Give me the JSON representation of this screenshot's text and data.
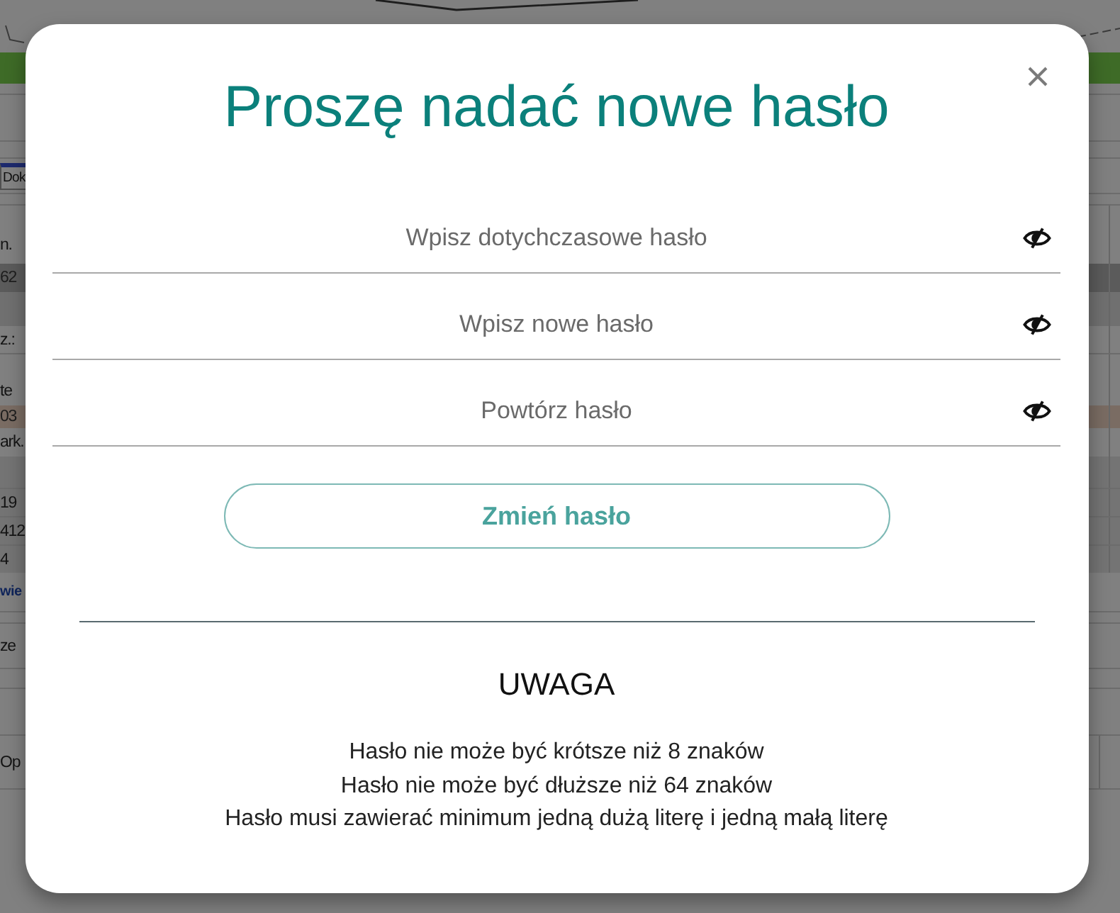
{
  "background_page": {
    "fragments": [
      {
        "text": "Dok",
        "kind": "tab"
      },
      {
        "text": "n.",
        "kind": "text"
      },
      {
        "text": "62",
        "kind": "text"
      },
      {
        "text": "z.:",
        "kind": "text"
      },
      {
        "text": "te",
        "kind": "text"
      },
      {
        "text": "03",
        "kind": "text"
      },
      {
        "text": "ark.",
        "kind": "text"
      },
      {
        "text": "19",
        "kind": "text"
      },
      {
        "text": "412",
        "kind": "text"
      },
      {
        "text": "4",
        "kind": "text"
      },
      {
        "text": "wie",
        "kind": "link"
      },
      {
        "text": "ze",
        "kind": "text"
      },
      {
        "text": "Op",
        "kind": "text"
      }
    ]
  },
  "dialog": {
    "title": "Proszę nadać nowe hasło",
    "fields": [
      {
        "placeholder": "Wpisz dotychczasowe hasło"
      },
      {
        "placeholder": "Wpisz nowe hasło"
      },
      {
        "placeholder": "Powtórz hasło"
      }
    ],
    "submit_button": "Zmień hasło",
    "notice": {
      "heading": "UWAGA",
      "lines": [
        "Hasło nie może być krótsze niż 8 znaków",
        "Hasło nie może być dłuższe niż 64 znaków",
        "Hasło musi zawierać minimum jedną dużą literę i jedną małą literę"
      ]
    }
  }
}
